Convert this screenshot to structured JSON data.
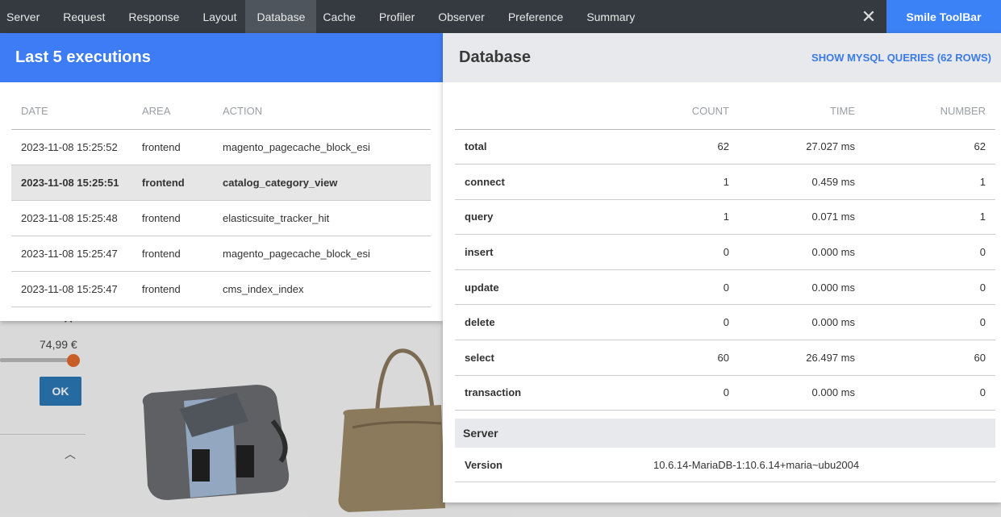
{
  "toolbar": {
    "tabs": [
      "Server",
      "Request",
      "Response",
      "Layout",
      "Database",
      "Cache",
      "Profiler",
      "Observer",
      "Preference",
      "Summary"
    ],
    "active_tab": "Database",
    "brand": "Smile ToolBar",
    "accent_color": "#3b82f6"
  },
  "executions": {
    "title": "Last 5 executions",
    "columns": [
      "DATE",
      "AREA",
      "ACTION"
    ],
    "rows": [
      {
        "date": "2023-11-08 15:25:52",
        "area": "frontend",
        "action": "magento_pagecache_block_esi"
      },
      {
        "date": "2023-11-08 15:25:51",
        "area": "frontend",
        "action": "catalog_category_view"
      },
      {
        "date": "2023-11-08 15:25:48",
        "area": "frontend",
        "action": "elasticsuite_tracker_hit"
      },
      {
        "date": "2023-11-08 15:25:47",
        "area": "frontend",
        "action": "magento_pagecache_block_esi"
      },
      {
        "date": "2023-11-08 15:25:47",
        "area": "frontend",
        "action": "cms_index_index"
      }
    ]
  },
  "database": {
    "title": "Database",
    "link": "SHOW MYSQL QUERIES (62 ROWS)",
    "columns": [
      "",
      "COUNT",
      "TIME",
      "NUMBER"
    ],
    "rows": [
      {
        "label": "total",
        "count": "62",
        "time": "27.027 ms",
        "number": "62"
      },
      {
        "label": "connect",
        "count": "1",
        "time": "0.459 ms",
        "number": "1"
      },
      {
        "label": "query",
        "count": "1",
        "time": "0.071 ms",
        "number": "1"
      },
      {
        "label": "insert",
        "count": "0",
        "time": "0.000 ms",
        "number": "0"
      },
      {
        "label": "update",
        "count": "0",
        "time": "0.000 ms",
        "number": "0"
      },
      {
        "label": "delete",
        "count": "0",
        "time": "0.000 ms",
        "number": "0"
      },
      {
        "label": "select",
        "count": "60",
        "time": "26.497 ms",
        "number": "60"
      },
      {
        "label": "transaction",
        "count": "0",
        "time": "0.000 ms",
        "number": "0"
      }
    ],
    "server_title": "Server",
    "server_label": "Version",
    "server_value": "10.6.14-MariaDB-1:10.6.14+maria~ubu2004"
  },
  "background": {
    "price": "74,99 €",
    "ok_label": "OK"
  }
}
